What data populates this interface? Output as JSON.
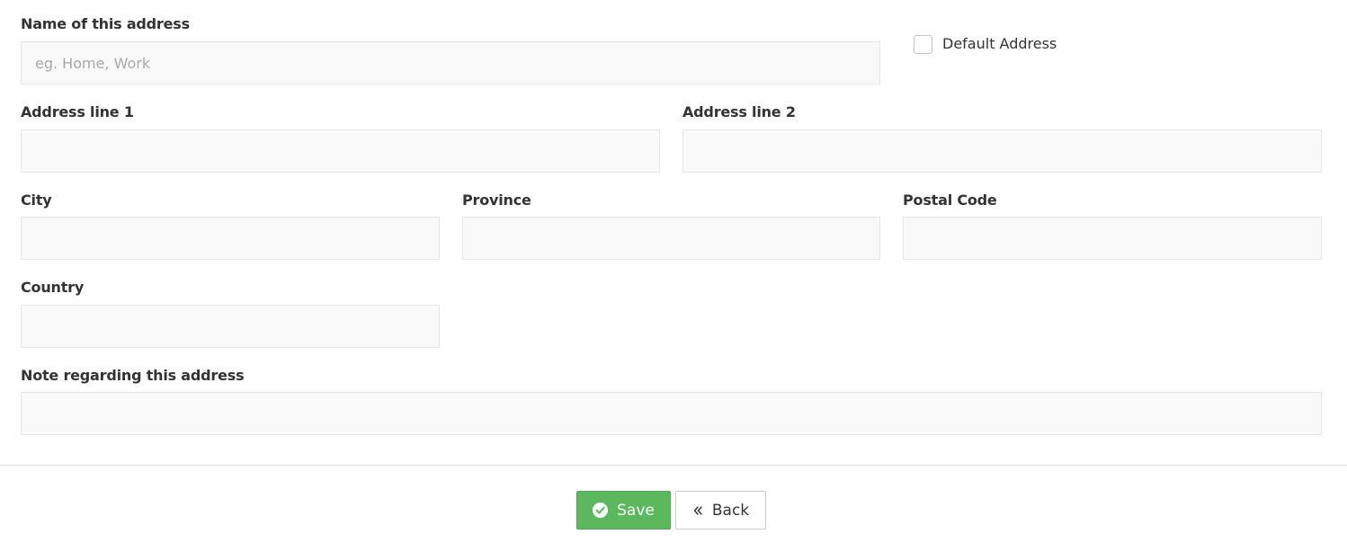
{
  "form": {
    "name": {
      "label": "Name of this address",
      "placeholder": "eg. Home, Work",
      "value": ""
    },
    "default_address": {
      "label": "Default Address",
      "checked": false
    },
    "address_line_1": {
      "label": "Address line 1",
      "value": ""
    },
    "address_line_2": {
      "label": "Address line 2",
      "value": ""
    },
    "city": {
      "label": "City",
      "value": ""
    },
    "province": {
      "label": "Province",
      "value": ""
    },
    "postal_code": {
      "label": "Postal Code",
      "value": ""
    },
    "country": {
      "label": "Country",
      "value": ""
    },
    "note": {
      "label": "Note regarding this address",
      "value": ""
    }
  },
  "actions": {
    "save_label": "Save",
    "back_label": "Back",
    "save_icon": "check-circle-icon",
    "back_icon": "double-chevron-left-icon",
    "save_color": "#5cb85c"
  }
}
